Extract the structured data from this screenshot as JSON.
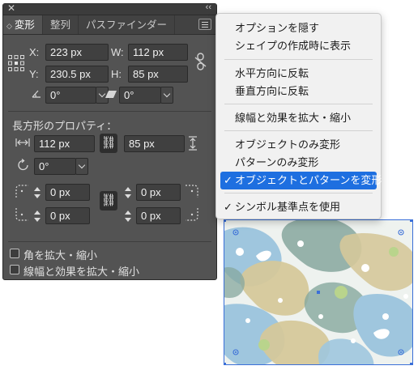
{
  "panel": {
    "tabs": [
      {
        "label": "変形",
        "active": true,
        "icon": "panel-grip-icon"
      },
      {
        "label": "整列",
        "active": false
      },
      {
        "label": "パスファインダー",
        "active": false
      }
    ],
    "close_glyph": "✕",
    "collapse_glyph": "‹‹",
    "x": {
      "label": "X:",
      "value": "223 px"
    },
    "y": {
      "label": "Y:",
      "value": "230.5 px"
    },
    "w": {
      "label": "W:",
      "value": "112 px"
    },
    "h": {
      "label": "H:",
      "value": "85 px"
    },
    "angle": {
      "value": "0°"
    },
    "shear": {
      "value": "0°"
    },
    "rect_section_title": "長方形のプロパティ：",
    "rect_w": "112 px",
    "rect_h": "85 px",
    "rect_angle": "0°",
    "corners": {
      "tl": "0 px",
      "tr": "0 px",
      "bl": "0 px",
      "br": "0 px"
    },
    "checkbox_scale_corners": {
      "label": "角を拡大・縮小",
      "checked": false
    },
    "checkbox_scale_strokes": {
      "label": "線幅と効果を拡大・縮小",
      "checked": false
    }
  },
  "menu": {
    "items": [
      {
        "label": "オプションを隠す",
        "checked": false
      },
      {
        "label": "シェイプの作成時に表示",
        "checked": false
      },
      {
        "label": "水平方向に反転",
        "checked": false
      },
      {
        "label": "垂直方向に反転",
        "checked": false
      },
      {
        "label": "線幅と効果を拡大・縮小",
        "checked": false
      },
      {
        "label": "オブジェクトのみ変形",
        "checked": false
      },
      {
        "label": "パターンのみ変形",
        "checked": false
      },
      {
        "label": "オブジェクトとパターンを変形",
        "checked": true,
        "highlighted": true
      },
      {
        "label": "シンボル基準点を使用",
        "checked": true
      }
    ],
    "check_glyph": "✓"
  },
  "colors": {
    "panel_bg": "#535353",
    "menu_highlight": "#1e6fe0",
    "selection_blue": "#3a6fd8",
    "pattern_blue": "#9fc6de",
    "pattern_tan": "#d5c89a",
    "pattern_teal": "#86a79d",
    "pattern_green": "#b9d48c"
  }
}
